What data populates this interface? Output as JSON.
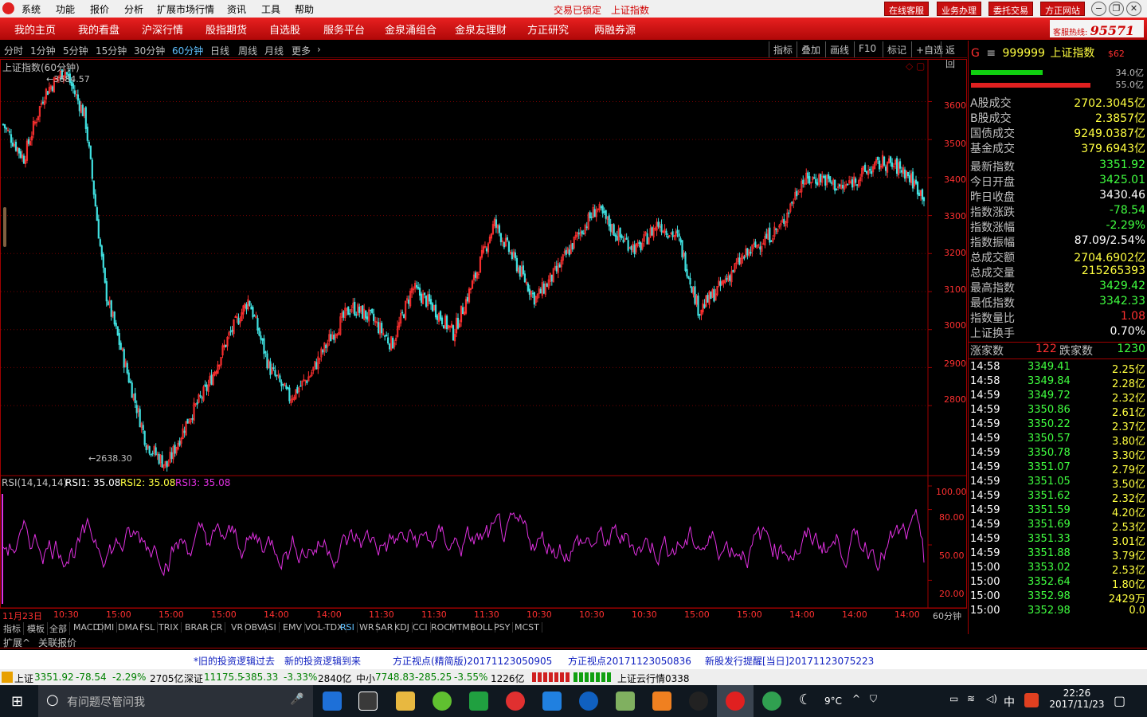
{
  "menu": {
    "items": [
      "系统",
      "功能",
      "报价",
      "分析",
      "扩展市场行情",
      "资讯",
      "工具",
      "帮助"
    ],
    "lock_status": "交易已锁定",
    "index_name": "上证指数"
  },
  "top_buttons": [
    "在线客服",
    "业务办理",
    "委托交易",
    "方正网站"
  ],
  "nav": {
    "items": [
      "我的主页",
      "我的看盘",
      "沪深行情",
      "股指期货",
      "自选股",
      "服务平台",
      "金泉涌组合",
      "金泉友理财",
      "方正研究",
      "两融券源"
    ],
    "hotline_label": "客服热线:",
    "hotline_number": "95571"
  },
  "periods": {
    "items": [
      "分时",
      "1分钟",
      "5分钟",
      "15分钟",
      "30分钟",
      "60分钟",
      "日线",
      "周线",
      "月线",
      "更多"
    ],
    "active": "60分钟"
  },
  "chart_tools": [
    "指标",
    "叠加",
    "画线",
    "F10",
    "标记",
    "+自选",
    "返回"
  ],
  "chart": {
    "title": "上证指数(60分钟)",
    "high_label": "3684.57",
    "low_label": "2638.30",
    "y_ticks": [
      "3600",
      "3500",
      "3400",
      "3300",
      "3200",
      "3100",
      "3000",
      "2900",
      "2800"
    ],
    "rsi_title": "RSI(14,14,14)",
    "rsi1": "RSI1: 35.08",
    "rsi2": "RSI2: 35.08",
    "rsi3": "RSI3: 35.08",
    "rsi_ticks": [
      "100.00",
      "80.00",
      "50.00",
      "20.00"
    ],
    "x_labels": [
      "11月23日",
      "10:30",
      "15:00",
      "15:00",
      "15:00",
      "14:00",
      "14:00",
      "11:30",
      "11:30",
      "11:30",
      "10:30",
      "10:30",
      "10:30",
      "15:00",
      "15:00",
      "14:00",
      "14:00",
      "14:00"
    ],
    "period_tag": "60分钟",
    "colors": {
      "up": "#ff3030",
      "down": "#40e0e0",
      "rsi": "#e030e0",
      "grid": "#700000"
    }
  },
  "chart_data": {
    "type": "candlestick",
    "title": "上证指数(60分钟)",
    "y_ticks": [
      3600,
      3500,
      3400,
      3300,
      3200,
      3100,
      3000,
      2900,
      2800
    ],
    "ylim": [
      2620,
      3710
    ],
    "approx_close_path": [
      3540,
      3450,
      3620,
      3684,
      3560,
      3100,
      2900,
      2700,
      2640,
      2760,
      2850,
      2980,
      3080,
      2900,
      2820,
      2880,
      2980,
      3060,
      3030,
      2960,
      3110,
      3060,
      2990,
      3130,
      3280,
      3180,
      3080,
      3150,
      3240,
      3320,
      3250,
      3210,
      3280,
      3240,
      3050,
      3110,
      3180,
      3230,
      3270,
      3390,
      3400,
      3370,
      3410,
      3440,
      3420,
      3352
    ],
    "rsi_series": {
      "name": "RSI1",
      "last": 35.08,
      "range": [
        0,
        100
      ],
      "ticks": [
        20,
        50,
        80,
        100
      ]
    }
  },
  "quote": {
    "code": "999999",
    "name": "上证指数",
    "tag": "$62",
    "bar_values": [
      "34.0亿",
      "55.0亿"
    ],
    "turnover": [
      {
        "k": "A股成交",
        "v": "2702.3045亿"
      },
      {
        "k": "B股成交",
        "v": "2.3857亿"
      },
      {
        "k": "国债成交",
        "v": "9249.0387亿"
      },
      {
        "k": "基金成交",
        "v": "379.6943亿"
      }
    ],
    "stats": [
      {
        "k": "最新指数",
        "v": "3351.92",
        "c": "#40ff40"
      },
      {
        "k": "今日开盘",
        "v": "3425.01",
        "c": "#40ff40"
      },
      {
        "k": "昨日收盘",
        "v": "3430.46",
        "c": "#ffffff"
      },
      {
        "k": "指数涨跌",
        "v": "-78.54",
        "c": "#40ff40"
      },
      {
        "k": "指数涨幅",
        "v": "-2.29%",
        "c": "#40ff40"
      },
      {
        "k": "指数振幅",
        "v": "87.09/2.54%",
        "c": "#ffffff"
      },
      {
        "k": "总成交额",
        "v": "2704.6902亿",
        "c": "#ffff40"
      },
      {
        "k": "总成交量",
        "v": "215265393",
        "c": "#ffff40"
      },
      {
        "k": "最高指数",
        "v": "3429.42",
        "c": "#40ff40"
      },
      {
        "k": "最低指数",
        "v": "3342.33",
        "c": "#40ff40"
      },
      {
        "k": "指数量比",
        "v": "1.08",
        "c": "#ff3030"
      },
      {
        "k": "上证换手",
        "v": "0.70%",
        "c": "#ffffff"
      }
    ],
    "rise_label": "涨家数",
    "rise_count": "122",
    "fall_label": "跌家数",
    "fall_count": "1230",
    "ticks": [
      {
        "t": "14:58",
        "p": "3349.41",
        "a": "2.25亿"
      },
      {
        "t": "14:58",
        "p": "3349.84",
        "a": "2.28亿"
      },
      {
        "t": "14:59",
        "p": "3349.72",
        "a": "2.32亿"
      },
      {
        "t": "14:59",
        "p": "3350.86",
        "a": "2.61亿"
      },
      {
        "t": "14:59",
        "p": "3350.22",
        "a": "2.37亿"
      },
      {
        "t": "14:59",
        "p": "3350.57",
        "a": "3.80亿"
      },
      {
        "t": "14:59",
        "p": "3350.78",
        "a": "3.30亿"
      },
      {
        "t": "14:59",
        "p": "3351.07",
        "a": "2.79亿"
      },
      {
        "t": "14:59",
        "p": "3351.05",
        "a": "3.50亿"
      },
      {
        "t": "14:59",
        "p": "3351.62",
        "a": "2.32亿"
      },
      {
        "t": "14:59",
        "p": "3351.59",
        "a": "4.20亿"
      },
      {
        "t": "14:59",
        "p": "3351.69",
        "a": "2.53亿"
      },
      {
        "t": "14:59",
        "p": "3351.33",
        "a": "3.01亿"
      },
      {
        "t": "14:59",
        "p": "3351.88",
        "a": "3.79亿"
      },
      {
        "t": "15:00",
        "p": "3353.02",
        "a": "2.53亿"
      },
      {
        "t": "15:00",
        "p": "3352.64",
        "a": "1.80亿"
      },
      {
        "t": "15:00",
        "p": "3352.98",
        "a": "2429万"
      },
      {
        "t": "15:00",
        "p": "3352.98",
        "a": "0.0"
      }
    ]
  },
  "indicator_bar": {
    "items": [
      "指标",
      "模板",
      "全部",
      "MACD",
      "DMI",
      "DMA",
      "FSL",
      "TRIX",
      "BRAR",
      "CR",
      "VR",
      "OBV",
      "ASI",
      "EMV",
      "VOL-TDX",
      "RSI",
      "WR",
      "SAR",
      "KDJ",
      "CCI",
      "ROC",
      "MTM",
      "BOLL",
      "PSY",
      "MCST"
    ],
    "active": "RSI"
  },
  "bottom_tabs": [
    "扩展^",
    "关联报价"
  ],
  "news": [
    "*旧的投资逻辑过去",
    "新的投资逻辑到来",
    "方正视点(精简版)20171123050905",
    "方正视点20171123050836",
    "新股发行提醒[当日]20171123075223"
  ],
  "status": {
    "sh": "上证",
    "sh_val": "3351.92",
    "sh_chg": "-78.54",
    "sh_pct": "-2.29%",
    "sh_amt": "2705亿",
    "sz": "深证",
    "sz_val": "11175.5",
    "sz_chg": "-385.33",
    "sz_pct": "-3.33%",
    "sz_amt": "2840亿",
    "zx": "中小",
    "zx_val": "7748.83",
    "zx_chg": "-285.25",
    "zx_pct": "-3.55%",
    "zx_amt": "1226亿",
    "cloud": "上证云行情0338"
  },
  "taskbar": {
    "search_placeholder": "有问题尽管问我",
    "weather": "9°C",
    "time": "22:26",
    "date": "2017/11/23",
    "ime": "中"
  }
}
